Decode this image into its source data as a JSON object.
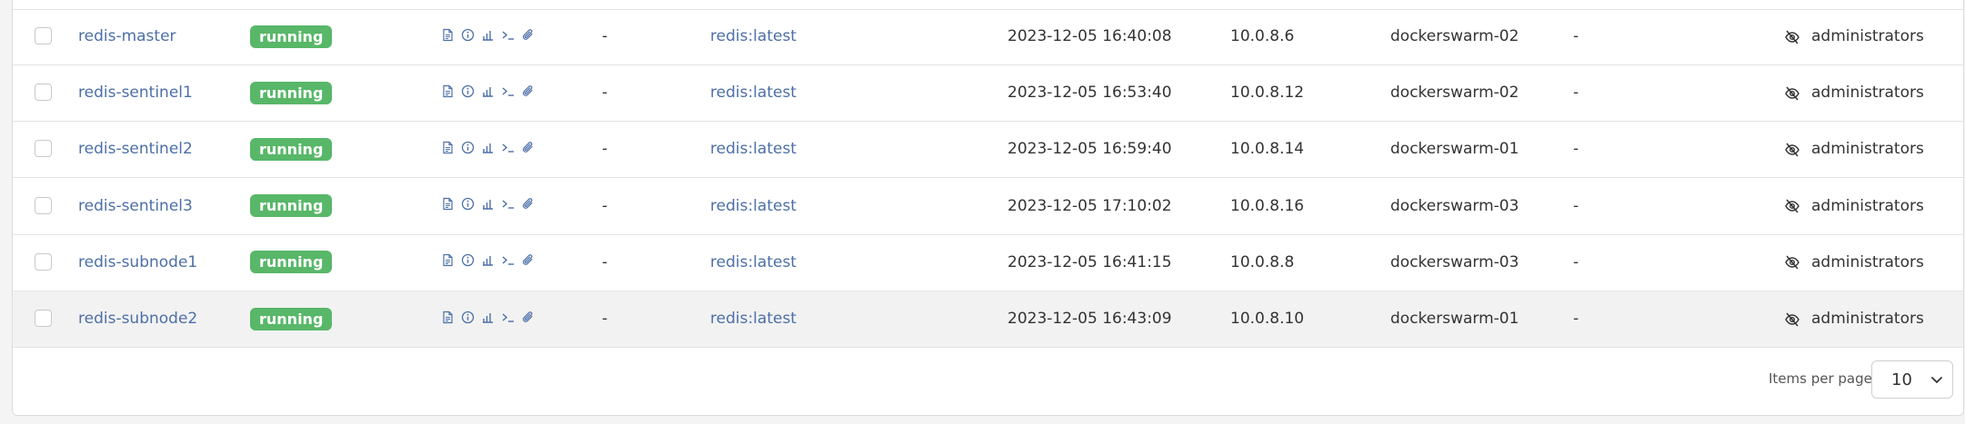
{
  "colors": {
    "accent_link": "#4d6fa8",
    "status_running": "#58b768",
    "row_highlight": "#f2f2f2"
  },
  "actions": [
    {
      "icon": "logs-icon"
    },
    {
      "icon": "inspect-icon"
    },
    {
      "icon": "stats-icon"
    },
    {
      "icon": "console-icon"
    },
    {
      "icon": "attach-icon"
    }
  ],
  "ownership_icon": "eye-off-icon",
  "rows": [
    {
      "name": "redis-master",
      "state": "running",
      "stack": "-",
      "image": "redis:latest",
      "created": "2023-12-05 16:40:08",
      "ip": "10.0.8.6",
      "host": "dockerswarm-02",
      "ports": "-",
      "ownership": "administrators"
    },
    {
      "name": "redis-sentinel1",
      "state": "running",
      "stack": "-",
      "image": "redis:latest",
      "created": "2023-12-05 16:53:40",
      "ip": "10.0.8.12",
      "host": "dockerswarm-02",
      "ports": "-",
      "ownership": "administrators"
    },
    {
      "name": "redis-sentinel2",
      "state": "running",
      "stack": "-",
      "image": "redis:latest",
      "created": "2023-12-05 16:59:40",
      "ip": "10.0.8.14",
      "host": "dockerswarm-01",
      "ports": "-",
      "ownership": "administrators"
    },
    {
      "name": "redis-sentinel3",
      "state": "running",
      "stack": "-",
      "image": "redis:latest",
      "created": "2023-12-05 17:10:02",
      "ip": "10.0.8.16",
      "host": "dockerswarm-03",
      "ports": "-",
      "ownership": "administrators"
    },
    {
      "name": "redis-subnode1",
      "state": "running",
      "stack": "-",
      "image": "redis:latest",
      "created": "2023-12-05 16:41:15",
      "ip": "10.0.8.8",
      "host": "dockerswarm-03",
      "ports": "-",
      "ownership": "administrators"
    },
    {
      "name": "redis-subnode2",
      "state": "running",
      "stack": "-",
      "image": "redis:latest",
      "created": "2023-12-05 16:43:09",
      "ip": "10.0.8.10",
      "host": "dockerswarm-01",
      "ports": "-",
      "ownership": "administrators",
      "highlighted": true
    }
  ],
  "pagination": {
    "items_per_page_label": "Items per page",
    "items_per_page_value": "10"
  }
}
